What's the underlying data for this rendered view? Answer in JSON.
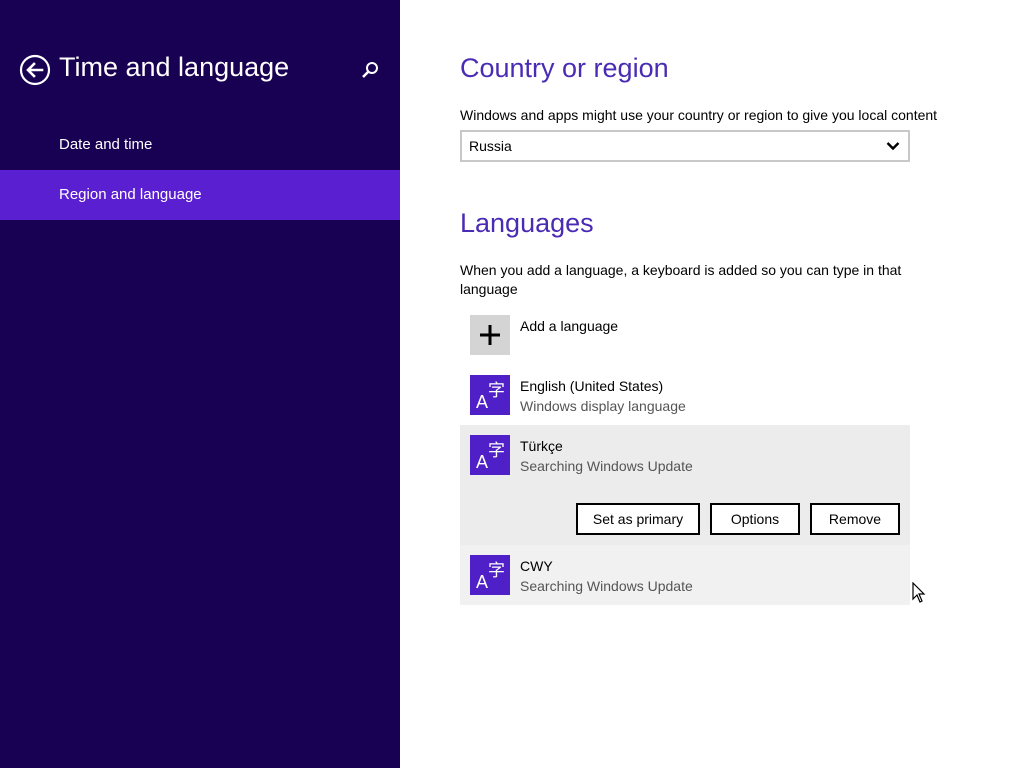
{
  "sidebar": {
    "title": "Time and language",
    "items": [
      {
        "label": "Date and time",
        "selected": false
      },
      {
        "label": "Region and language",
        "selected": true
      }
    ]
  },
  "country": {
    "heading": "Country or region",
    "description": "Windows and apps might use your country or region to give you local content",
    "selected": "Russia"
  },
  "languages": {
    "heading": "Languages",
    "description": "When you add a language, a keyboard is added so you can type in that language",
    "add_label": "Add a language",
    "list": [
      {
        "name": "English (United States)",
        "status": "Windows display language"
      },
      {
        "name": "Türkçe",
        "status": "Searching Windows Update"
      },
      {
        "name": "CWY",
        "status": "Searching Windows Update"
      }
    ],
    "actions": {
      "set_primary": "Set as primary",
      "options": "Options",
      "remove": "Remove"
    }
  },
  "colors": {
    "sidebar_bg": "#180052",
    "selected_item": "#5b1fd2",
    "heading": "#4a2bb3",
    "language_tile": "#4f1fc7"
  }
}
